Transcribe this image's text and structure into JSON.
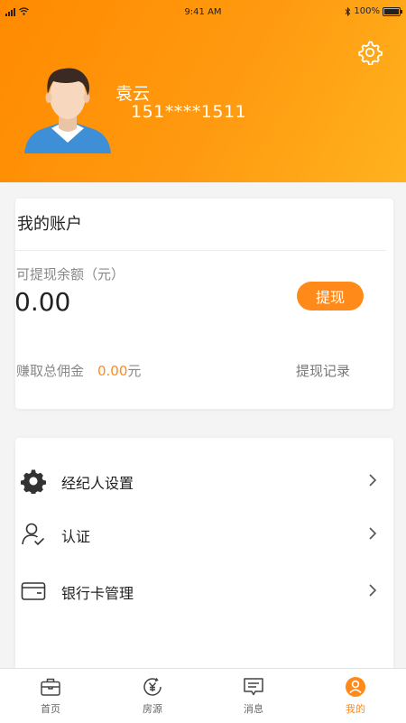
{
  "status_bar": {
    "time": "9:41 AM",
    "battery": "100%"
  },
  "profile": {
    "name": "袁云",
    "phone": "151****1511"
  },
  "account": {
    "title": "我的账户",
    "balance_label": "可提现余额（元）",
    "balance_value": "0.00",
    "withdraw_label": "提现",
    "commission_label": "赚取总佣金",
    "commission_value": "0.00",
    "commission_unit": "元",
    "record_label": "提现记录"
  },
  "menu": [
    {
      "label": "经纪人设置",
      "icon": "gear-icon"
    },
    {
      "label": "认证",
      "icon": "user-check-icon"
    },
    {
      "label": "银行卡管理",
      "icon": "bank-card-icon"
    }
  ],
  "tabs": [
    {
      "label": "首页",
      "icon": "briefcase-icon"
    },
    {
      "label": "房源",
      "icon": "yuan-icon"
    },
    {
      "label": "消息",
      "icon": "message-icon"
    },
    {
      "label": "我的",
      "icon": "profile-icon"
    }
  ],
  "active_tab": "我的",
  "colors": {
    "accent": "#ff8a1a",
    "header_start": "#ff8a00",
    "header_end": "#ffb21e"
  }
}
